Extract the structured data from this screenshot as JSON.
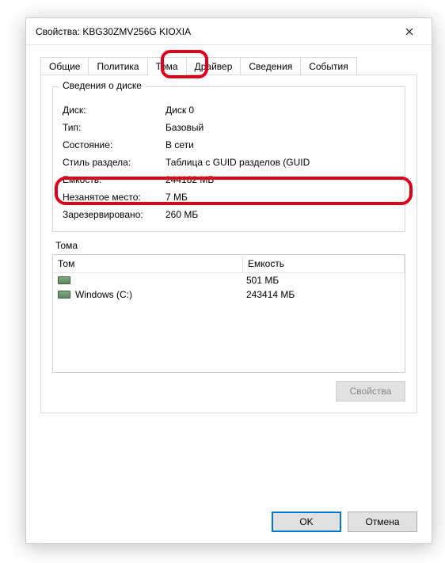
{
  "window": {
    "title": "Свойства: KBG30ZMV256G KIOXIA"
  },
  "tabs": {
    "general": "Общие",
    "policy": "Политика",
    "volumes": "Тома",
    "driver": "Драйвер",
    "details": "Сведения",
    "events": "События"
  },
  "disk_info": {
    "legend": "Сведения о диске",
    "rows": {
      "disk": {
        "k": "Диск:",
        "v": "Диск 0"
      },
      "type": {
        "k": "Тип:",
        "v": "Базовый"
      },
      "status": {
        "k": "Состояние:",
        "v": "В сети"
      },
      "style": {
        "k": "Стиль раздела:",
        "v": "Таблица с GUID разделов (GUID"
      },
      "capacity": {
        "k": "Емкость:",
        "v": "244182 МБ"
      },
      "unalloc": {
        "k": "Незанятое место:",
        "v": "7 МБ"
      },
      "reserved": {
        "k": "Зарезервировано:",
        "v": "260 МБ"
      }
    }
  },
  "volumes": {
    "label": "Тома",
    "columns": {
      "name": "Том",
      "capacity": "Емкость"
    },
    "items": [
      {
        "name": "",
        "capacity": "501 МБ"
      },
      {
        "name": "Windows (C:)",
        "capacity": "243414 МБ"
      }
    ]
  },
  "buttons": {
    "properties": "Свойства",
    "ok": "OK",
    "cancel": "Отмена"
  }
}
